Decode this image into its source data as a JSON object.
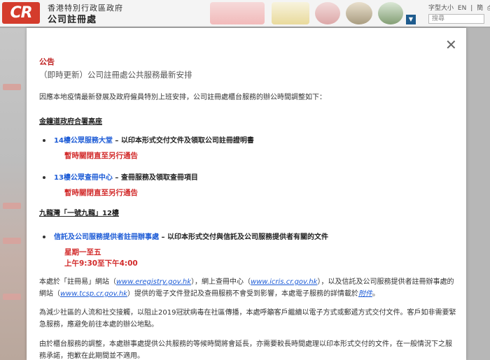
{
  "header": {
    "logo_text": "CR",
    "gov_line1": "香港特別行政區政府",
    "gov_line2": "公司註冊處",
    "font_size_label": "字型大小",
    "lang_en": "EN",
    "lang_sep": "|",
    "lang_simplified": "簡",
    "search_placeholder": "搜尋"
  },
  "modal": {
    "close_symbol": "✕",
    "announcement": "公告",
    "subtitle": "（即時更新）公司註冊處公共服務最新安排",
    "intro": "因應本地疫情最新發展及政府僱員特別上班安排，公司註冊處櫃台服務的辦公時間調整如下：",
    "location1": "金鐘道政府合署高座",
    "item1_link": "14樓公眾服務大堂",
    "item1_text": " – 以印本形式交付文件及領取公司註冊證明書",
    "item1_notice": "暫時關閉直至另行通告",
    "item2_link": "13樓公眾查冊中心",
    "item2_text": " – 查冊服務及領取查冊項目",
    "item2_notice": "暫時關閉直至另行通告",
    "location2": "九龍灣「一號九龍」12樓",
    "item3_link": "信託及公司服務提供者註冊辦事處",
    "item3_text": " – 以印本形式交付與信託及公司服務提供者有關的文件",
    "hours_days": "星期一至五",
    "hours_time": "上午9:30至下午4:00",
    "p1_a": "本處於「註冊易」網站（",
    "p1_link1": "www.eregistry.gov.hk",
    "p1_b": "），網上查冊中心（",
    "p1_link2": "www.icris.cr.gov.hk",
    "p1_c": "），以及信託及公司服務提供者註冊辦事處的",
    "p1_d": "網站（",
    "p1_link3": "www.tcsp.cr.gov.hk",
    "p1_e": "）提供的電子文件登記及查冊服務不會受到影響，本處電子服務的詳情載於",
    "p1_link4": "附件",
    "p1_f": "。",
    "p2": "為減少社區的人流和社交接觸，以阻止2019冠狀病毒在社區傳播，本處呼籲客戶繼續以電子方式或郵遞方式交付文件。客戶如非需要緊急服務，應避免前往本處的辦公地點。",
    "p3": "由於櫃台服務的調整，本處辦事處提供公共服務的等候時間將會延長，亦需要較長時間處理以印本形式交付的文件，在一般情況下之服務承諾，抱歉在此期間並不適用。"
  }
}
